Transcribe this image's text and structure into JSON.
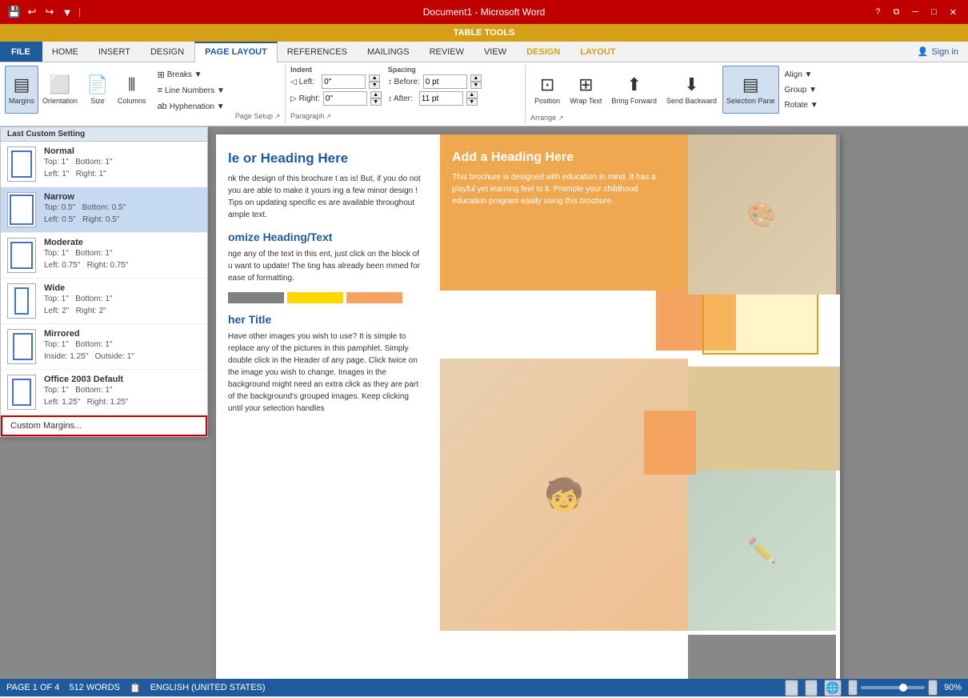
{
  "titleBar": {
    "title": "Document1 - Microsoft Word",
    "tableToolsLabel": "TABLE TOOLS",
    "closeBtn": "✕",
    "minimizeBtn": "─",
    "maximizeBtn": "□",
    "helpBtn": "?"
  },
  "tabs": [
    {
      "label": "FILE",
      "type": "file"
    },
    {
      "label": "HOME",
      "type": "normal"
    },
    {
      "label": "INSERT",
      "type": "normal"
    },
    {
      "label": "DESIGN",
      "type": "normal"
    },
    {
      "label": "PAGE LAYOUT",
      "type": "active"
    },
    {
      "label": "REFERENCES",
      "type": "normal"
    },
    {
      "label": "MAILINGS",
      "type": "normal"
    },
    {
      "label": "REVIEW",
      "type": "normal"
    },
    {
      "label": "VIEW",
      "type": "normal"
    },
    {
      "label": "DESIGN",
      "type": "table"
    },
    {
      "label": "LAYOUT",
      "type": "table"
    }
  ],
  "signIn": "Sign in",
  "ribbon": {
    "groups": [
      {
        "label": "Margins",
        "sublabel": ""
      },
      {
        "label": "Orientation",
        "sublabel": ""
      },
      {
        "label": "Size",
        "sublabel": ""
      },
      {
        "label": "Columns",
        "sublabel": ""
      },
      {
        "label": "Breaks ▼",
        "sublabel": ""
      },
      {
        "label": "Line Numbers ▼",
        "sublabel": ""
      },
      {
        "label": "Hyphenation ▼",
        "sublabel": ""
      },
      {
        "label": "Indent Left: 0\"",
        "sublabel": "Indent Right: 0\""
      },
      {
        "label": "Spacing Before: 0pt",
        "sublabel": "Spacing After: 11pt"
      },
      {
        "label": "Position",
        "sublabel": ""
      },
      {
        "label": "Wrap Text",
        "sublabel": ""
      },
      {
        "label": "Bring Forward",
        "sublabel": ""
      },
      {
        "label": "Send Backward",
        "sublabel": ""
      },
      {
        "label": "Selection Pane",
        "sublabel": ""
      },
      {
        "label": "Align ▼",
        "sublabel": ""
      },
      {
        "label": "Group ▼",
        "sublabel": ""
      },
      {
        "label": "Rotate ▼",
        "sublabel": ""
      }
    ],
    "indentLeft": "0\"",
    "indentRight": "0\"",
    "spacingBefore": "0 pt",
    "spacingAfter": "11 pt",
    "paragraphLabel": "Paragraph",
    "arrangeLabel": "Arrange"
  },
  "marginsDropdown": {
    "header": "Last Custom Setting",
    "items": [
      {
        "name": "Normal",
        "top": "Top: 1\"",
        "bottom": "Bottom: 1\"",
        "left": "Left: 1\"",
        "right": "Right: 1\"",
        "selected": false
      },
      {
        "name": "Narrow",
        "top": "Top: 0.5\"",
        "bottom": "Bottom: 0.5\"",
        "left": "Left: 0.5\"",
        "right": "Right: 0.5\"",
        "selected": true
      },
      {
        "name": "Moderate",
        "top": "Top: 1\"",
        "bottom": "Bottom: 1\"",
        "left": "Left: 0.75\"",
        "right": "Right: 0.75\"",
        "selected": false
      },
      {
        "name": "Wide",
        "top": "Top: 1\"",
        "bottom": "Bottom: 1\"",
        "left": "Left: 2\"",
        "right": "Right: 2\"",
        "selected": false
      },
      {
        "name": "Mirrored",
        "top": "Top: 1\"",
        "bottom": "Bottom: 1\"",
        "left": "Inside: 1.25\"",
        "right": "Outside: 1\"",
        "selected": false
      },
      {
        "name": "Office 2003 Default",
        "top": "Top: 1\"",
        "bottom": "Bottom: 1\"",
        "left": "Left: 1.25\"",
        "right": "Right: 1.25\"",
        "selected": false
      }
    ],
    "customMarginsLabel": "Custom Margins..."
  },
  "document": {
    "heading1": "le or Heading Here",
    "heading2": "Add a Heading Here",
    "heading3": "omize Heading/Text",
    "heading4": "her Title",
    "body1": "nk the design of this brochure t as is!  But, if you do not you are able to make it yours ing a few minor design !  Tips on updating specific es are available throughout ample text.",
    "body2": "This brochure is designed with education in mind.  It has a playful yet learning feel to it.  Promote your childhood education program easily using this brochure.",
    "body3": "nge any of the text in this ent, just click on the block of u want to update!  The ting has already been mmed for ease of formatting.",
    "body4": "Have other images you wish to use? It is simple to replace any of the pictures in this pamphlet.  Simply double click in the Header of any page.  Click twice on the image you wish to change.  Images in the background might need an extra click as they are part of the background's grouped images.  Keep clicking until your selection handles"
  },
  "statusBar": {
    "page": "PAGE 1 OF 4",
    "words": "512 WORDS",
    "language": "ENGLISH (UNITED STATES)",
    "zoom": "90%",
    "zoomPercent": 90
  }
}
